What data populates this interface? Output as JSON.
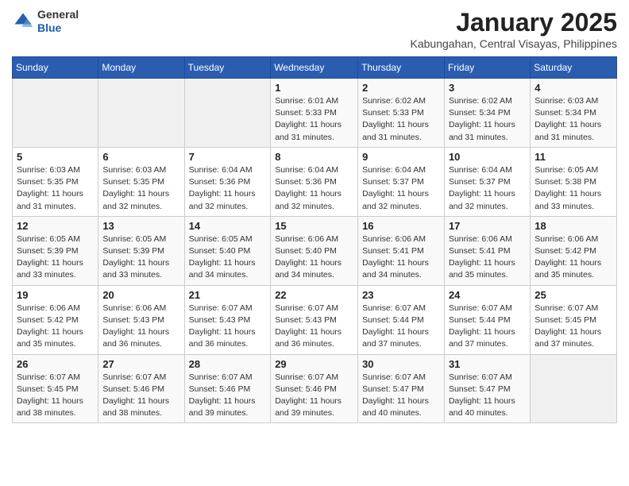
{
  "header": {
    "logo_line1": "General",
    "logo_line2": "Blue",
    "month": "January 2025",
    "location": "Kabungahan, Central Visayas, Philippines"
  },
  "weekdays": [
    "Sunday",
    "Monday",
    "Tuesday",
    "Wednesday",
    "Thursday",
    "Friday",
    "Saturday"
  ],
  "weeks": [
    [
      {
        "day": "",
        "info": ""
      },
      {
        "day": "",
        "info": ""
      },
      {
        "day": "",
        "info": ""
      },
      {
        "day": "1",
        "info": "Sunrise: 6:01 AM\nSunset: 5:33 PM\nDaylight: 11 hours\nand 31 minutes."
      },
      {
        "day": "2",
        "info": "Sunrise: 6:02 AM\nSunset: 5:33 PM\nDaylight: 11 hours\nand 31 minutes."
      },
      {
        "day": "3",
        "info": "Sunrise: 6:02 AM\nSunset: 5:34 PM\nDaylight: 11 hours\nand 31 minutes."
      },
      {
        "day": "4",
        "info": "Sunrise: 6:03 AM\nSunset: 5:34 PM\nDaylight: 11 hours\nand 31 minutes."
      }
    ],
    [
      {
        "day": "5",
        "info": "Sunrise: 6:03 AM\nSunset: 5:35 PM\nDaylight: 11 hours\nand 31 minutes."
      },
      {
        "day": "6",
        "info": "Sunrise: 6:03 AM\nSunset: 5:35 PM\nDaylight: 11 hours\nand 32 minutes."
      },
      {
        "day": "7",
        "info": "Sunrise: 6:04 AM\nSunset: 5:36 PM\nDaylight: 11 hours\nand 32 minutes."
      },
      {
        "day": "8",
        "info": "Sunrise: 6:04 AM\nSunset: 5:36 PM\nDaylight: 11 hours\nand 32 minutes."
      },
      {
        "day": "9",
        "info": "Sunrise: 6:04 AM\nSunset: 5:37 PM\nDaylight: 11 hours\nand 32 minutes."
      },
      {
        "day": "10",
        "info": "Sunrise: 6:04 AM\nSunset: 5:37 PM\nDaylight: 11 hours\nand 32 minutes."
      },
      {
        "day": "11",
        "info": "Sunrise: 6:05 AM\nSunset: 5:38 PM\nDaylight: 11 hours\nand 33 minutes."
      }
    ],
    [
      {
        "day": "12",
        "info": "Sunrise: 6:05 AM\nSunset: 5:39 PM\nDaylight: 11 hours\nand 33 minutes."
      },
      {
        "day": "13",
        "info": "Sunrise: 6:05 AM\nSunset: 5:39 PM\nDaylight: 11 hours\nand 33 minutes."
      },
      {
        "day": "14",
        "info": "Sunrise: 6:05 AM\nSunset: 5:40 PM\nDaylight: 11 hours\nand 34 minutes."
      },
      {
        "day": "15",
        "info": "Sunrise: 6:06 AM\nSunset: 5:40 PM\nDaylight: 11 hours\nand 34 minutes."
      },
      {
        "day": "16",
        "info": "Sunrise: 6:06 AM\nSunset: 5:41 PM\nDaylight: 11 hours\nand 34 minutes."
      },
      {
        "day": "17",
        "info": "Sunrise: 6:06 AM\nSunset: 5:41 PM\nDaylight: 11 hours\nand 35 minutes."
      },
      {
        "day": "18",
        "info": "Sunrise: 6:06 AM\nSunset: 5:42 PM\nDaylight: 11 hours\nand 35 minutes."
      }
    ],
    [
      {
        "day": "19",
        "info": "Sunrise: 6:06 AM\nSunset: 5:42 PM\nDaylight: 11 hours\nand 35 minutes."
      },
      {
        "day": "20",
        "info": "Sunrise: 6:06 AM\nSunset: 5:43 PM\nDaylight: 11 hours\nand 36 minutes."
      },
      {
        "day": "21",
        "info": "Sunrise: 6:07 AM\nSunset: 5:43 PM\nDaylight: 11 hours\nand 36 minutes."
      },
      {
        "day": "22",
        "info": "Sunrise: 6:07 AM\nSunset: 5:43 PM\nDaylight: 11 hours\nand 36 minutes."
      },
      {
        "day": "23",
        "info": "Sunrise: 6:07 AM\nSunset: 5:44 PM\nDaylight: 11 hours\nand 37 minutes."
      },
      {
        "day": "24",
        "info": "Sunrise: 6:07 AM\nSunset: 5:44 PM\nDaylight: 11 hours\nand 37 minutes."
      },
      {
        "day": "25",
        "info": "Sunrise: 6:07 AM\nSunset: 5:45 PM\nDaylight: 11 hours\nand 37 minutes."
      }
    ],
    [
      {
        "day": "26",
        "info": "Sunrise: 6:07 AM\nSunset: 5:45 PM\nDaylight: 11 hours\nand 38 minutes."
      },
      {
        "day": "27",
        "info": "Sunrise: 6:07 AM\nSunset: 5:46 PM\nDaylight: 11 hours\nand 38 minutes."
      },
      {
        "day": "28",
        "info": "Sunrise: 6:07 AM\nSunset: 5:46 PM\nDaylight: 11 hours\nand 39 minutes."
      },
      {
        "day": "29",
        "info": "Sunrise: 6:07 AM\nSunset: 5:46 PM\nDaylight: 11 hours\nand 39 minutes."
      },
      {
        "day": "30",
        "info": "Sunrise: 6:07 AM\nSunset: 5:47 PM\nDaylight: 11 hours\nand 40 minutes."
      },
      {
        "day": "31",
        "info": "Sunrise: 6:07 AM\nSunset: 5:47 PM\nDaylight: 11 hours\nand 40 minutes."
      },
      {
        "day": "",
        "info": ""
      }
    ]
  ]
}
